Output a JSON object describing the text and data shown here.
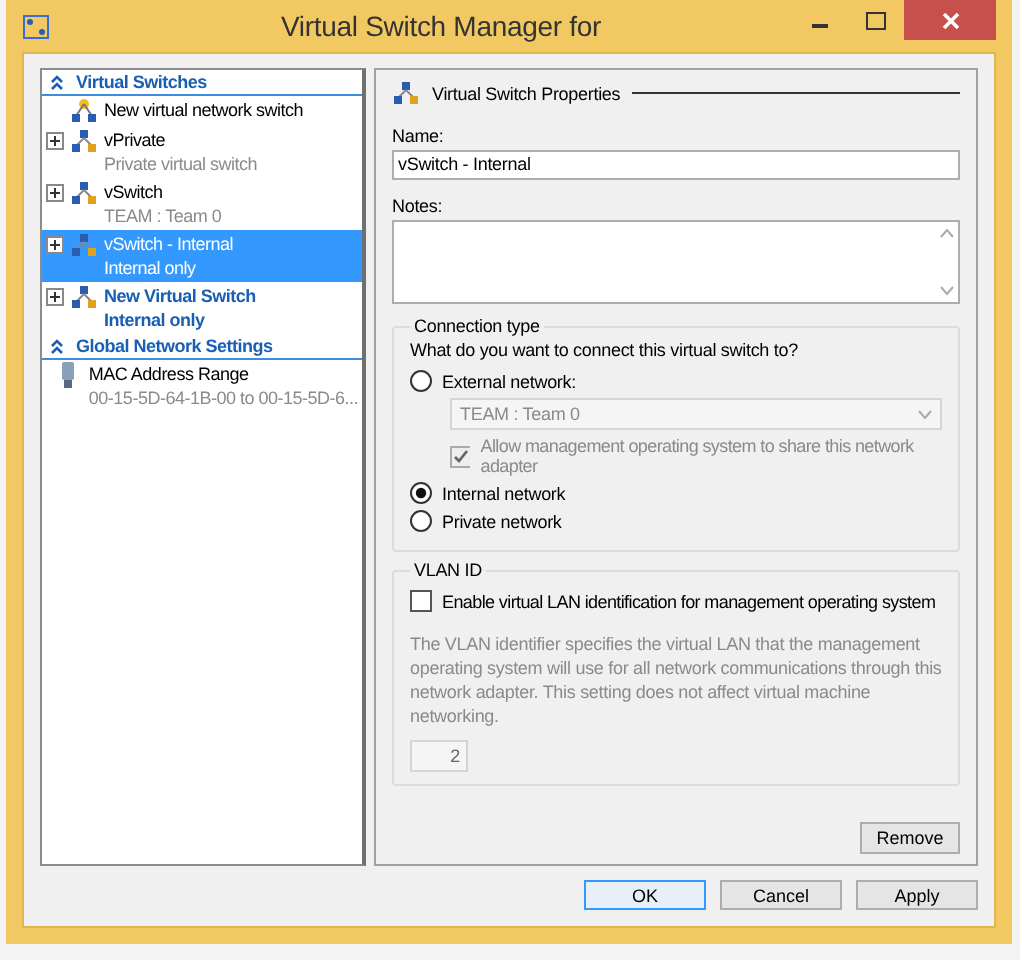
{
  "window": {
    "title": "Virtual Switch Manager for"
  },
  "sidebar": {
    "sections": [
      {
        "label": "Virtual Switches",
        "expanded": true,
        "items": [
          {
            "kind": "new_switch",
            "label": "New virtual network switch",
            "selected": false,
            "pending": false
          },
          {
            "kind": "switch",
            "label": "vPrivate",
            "sublabel": "Private virtual switch",
            "expanded": false,
            "selected": false,
            "pending": false
          },
          {
            "kind": "switch",
            "label": "vSwitch",
            "sublabel": "TEAM : Team 0",
            "expanded": false,
            "selected": false,
            "pending": false
          },
          {
            "kind": "switch",
            "label": "vSwitch - Internal",
            "sublabel": "Internal only",
            "expanded": false,
            "selected": true,
            "pending": false
          },
          {
            "kind": "switch",
            "label": "New Virtual Switch",
            "sublabel": "Internal only",
            "expanded": false,
            "selected": false,
            "pending": true
          }
        ]
      },
      {
        "label": "Global Network Settings",
        "expanded": true,
        "items": [
          {
            "kind": "mac_range",
            "label": "MAC Address Range",
            "sublabel": "00-15-5D-64-1B-00 to 00-15-5D-6...",
            "selected": false,
            "pending": false
          }
        ]
      }
    ]
  },
  "properties": {
    "heading": "Virtual Switch Properties",
    "name_label": "Name:",
    "name_value": "vSwitch - Internal",
    "notes_label": "Notes:",
    "connection": {
      "title": "Connection type",
      "question": "What do you want to connect this virtual switch to?",
      "options": [
        {
          "label": "External network:",
          "selected": false,
          "adapter": "TEAM : Team 0",
          "share_label": "Allow management operating system to share this network adapter",
          "share_checked": true,
          "disabled": true
        },
        {
          "label": "Internal network",
          "selected": true
        },
        {
          "label": "Private network",
          "selected": false
        }
      ]
    },
    "vlan": {
      "title": "VLAN ID",
      "checkbox_label": "Enable virtual LAN identification for management operating system",
      "checked": false,
      "description": "The VLAN identifier specifies the virtual LAN that the management operating system will use for all network communications through this network adapter. This setting does not affect virtual machine networking.",
      "value": "2"
    },
    "remove_button": "Remove"
  },
  "buttons": [
    {
      "label": "OK",
      "default": true
    },
    {
      "label": "Cancel",
      "default": false
    },
    {
      "label": "Apply",
      "default": false
    }
  ]
}
